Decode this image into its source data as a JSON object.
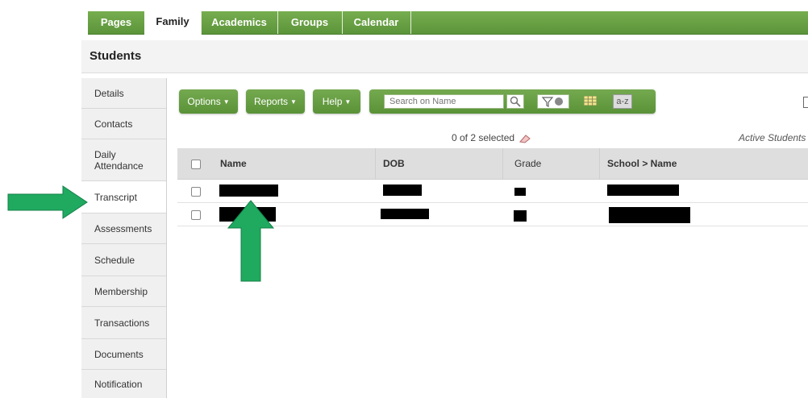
{
  "nav": {
    "tabs": [
      {
        "label": "Pages"
      },
      {
        "label": "Family"
      },
      {
        "label": "Academics"
      },
      {
        "label": "Groups"
      },
      {
        "label": "Calendar"
      }
    ]
  },
  "page_title": "Students",
  "sidebar": {
    "items": [
      {
        "label": "Details"
      },
      {
        "label": "Contacts"
      },
      {
        "label": "Daily Attendance"
      },
      {
        "label": "Transcript"
      },
      {
        "label": "Assessments"
      },
      {
        "label": "Schedule"
      },
      {
        "label": "Membership"
      },
      {
        "label": "Transactions"
      },
      {
        "label": "Documents"
      },
      {
        "label": "Notification"
      }
    ]
  },
  "toolbar": {
    "options_label": "Options",
    "reports_label": "Reports",
    "help_label": "Help",
    "search_placeholder": "Search on Name",
    "sort_label": "a-z"
  },
  "selection_status": "0 of 2 selected",
  "filter_label": "Active Students",
  "table": {
    "columns": [
      "Name",
      "DOB",
      "Grade",
      "School > Name"
    ]
  },
  "colors": {
    "accent_green": "#5f9a3c",
    "arrow_green": "#1faa5f"
  }
}
